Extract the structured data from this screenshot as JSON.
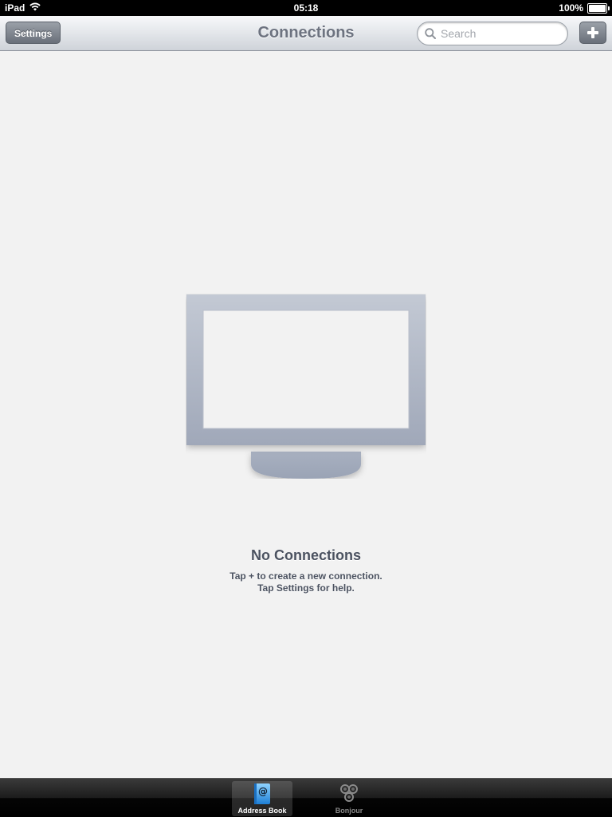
{
  "status_bar": {
    "device": "iPad",
    "time": "05:18",
    "battery": "100%",
    "battery_level": 1.0
  },
  "nav_bar": {
    "title": "Connections",
    "settings_label": "Settings",
    "search_placeholder": "Search",
    "search_value": "",
    "add_icon": "plus-icon"
  },
  "empty_state": {
    "icon": "monitor-icon",
    "title": "No Connections",
    "line1": "Tap + to create a new connection.",
    "line2": "Tap Settings for help."
  },
  "tab_bar": {
    "tabs": [
      {
        "label": "Address Book",
        "icon": "address-book-icon",
        "active": true
      },
      {
        "label": "Bonjour",
        "icon": "bonjour-icon",
        "active": false
      }
    ]
  },
  "colors": {
    "background": "#f2f2f2",
    "monitor": "#a4acbd",
    "text": "#4b5260",
    "title": "#6d7380"
  }
}
